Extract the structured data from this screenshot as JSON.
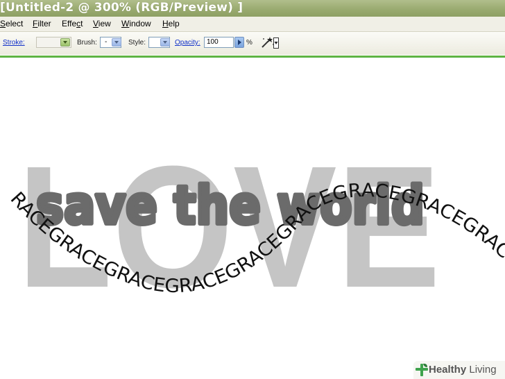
{
  "window": {
    "title": "[Untitled-2 @ 300% (RGB/Preview) ]"
  },
  "menu": {
    "items": [
      {
        "label": "Select",
        "mnemonic": "S"
      },
      {
        "label": "Filter",
        "mnemonic": "F"
      },
      {
        "label": "Effect",
        "mnemonic": "c"
      },
      {
        "label": "View",
        "mnemonic": "V"
      },
      {
        "label": "Window",
        "mnemonic": "W"
      },
      {
        "label": "Help",
        "mnemonic": "H"
      }
    ]
  },
  "options": {
    "stroke_label": "Stroke:",
    "stroke_value": "",
    "brush_label": "Brush:",
    "brush_value": "-",
    "style_label": "Style:",
    "style_value": "",
    "opacity_label": "Opacity:",
    "opacity_value": "100",
    "opacity_unit": "%"
  },
  "canvas": {
    "background_word": "LOVE",
    "headline": "save the world",
    "path_text": "RACEGRACEGRACEGRACEGRACEGRACEGRACEGRACEGRACEGR",
    "colors": {
      "love_fill": "#c5c5c5",
      "headline_fill": "#6b6b6b",
      "path_text_fill": "#111111"
    }
  },
  "watermark": {
    "bold": "Healthy",
    "light": "Living",
    "icon": "cross-leaf-icon",
    "color": "#3fa34d"
  }
}
